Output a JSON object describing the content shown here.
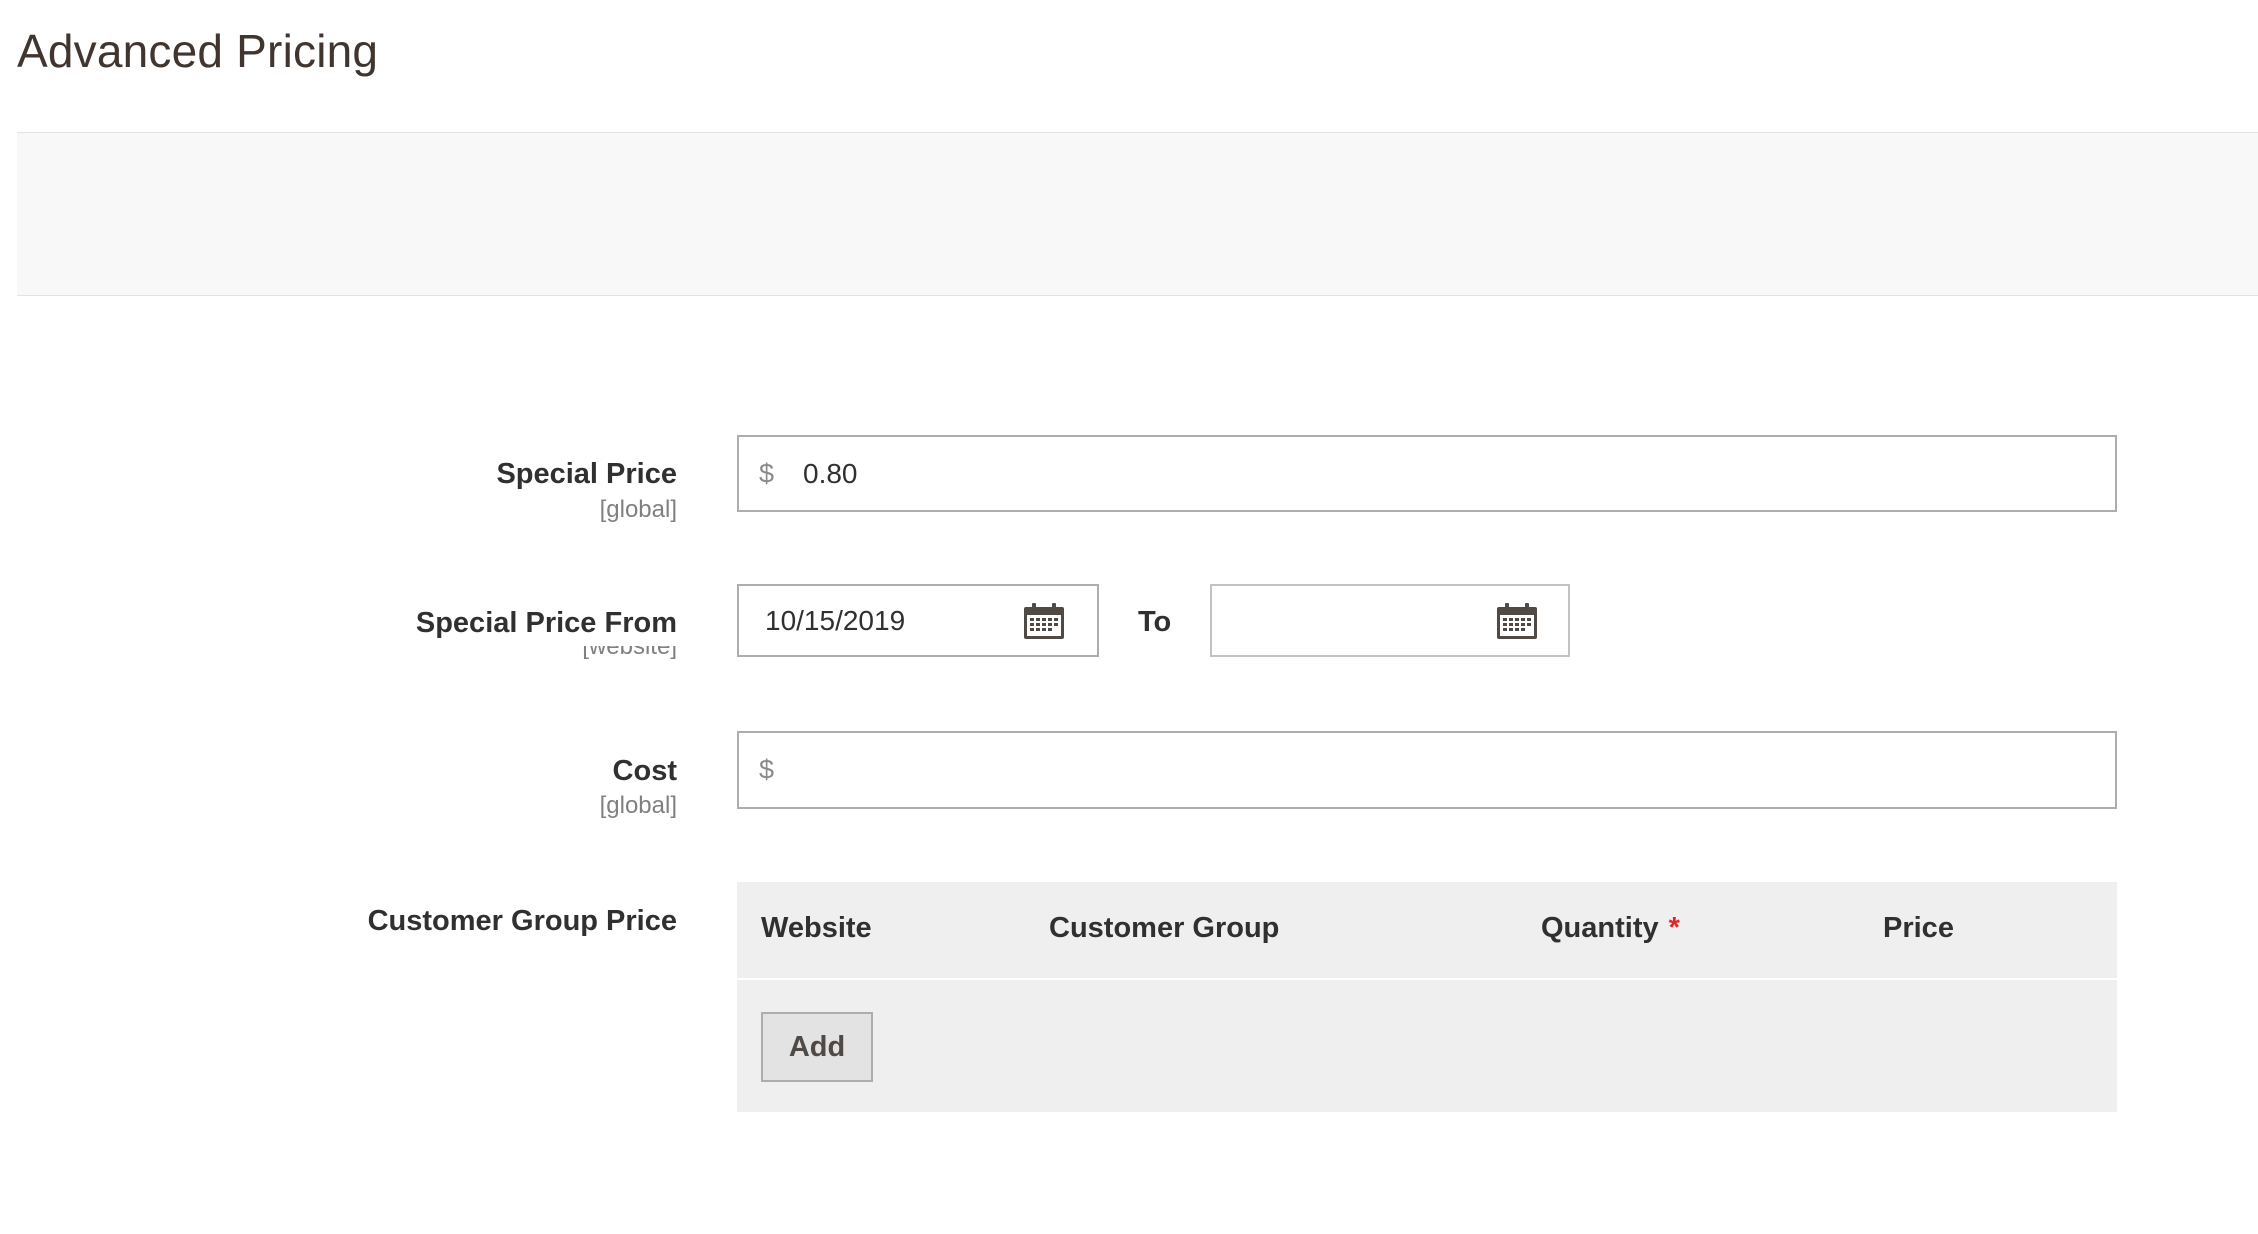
{
  "modal": {
    "title": "Advanced Pricing"
  },
  "fields": {
    "special_price": {
      "label": "Special Price",
      "scope": "[global]",
      "currency": "$",
      "value": "0.80"
    },
    "special_price_from": {
      "label": "Special Price From",
      "scope": "[website]",
      "from_value": "10/15/2019",
      "to_label": "To",
      "to_value": ""
    },
    "cost": {
      "label": "Cost",
      "scope": "[global]",
      "currency": "$",
      "value": ""
    },
    "customer_group_price": {
      "label": "Customer Group Price",
      "columns": {
        "website": "Website",
        "customer_group": "Customer Group",
        "quantity": "Quantity",
        "quantity_required": "*",
        "price": "Price"
      },
      "add_button": "Add"
    }
  },
  "colors": {
    "title": "#41362f",
    "required": "#e22626",
    "grid_bg": "#efefef",
    "header_band": "#f8f8f8"
  },
  "icons": {
    "date_picker": "calendar-icon"
  }
}
